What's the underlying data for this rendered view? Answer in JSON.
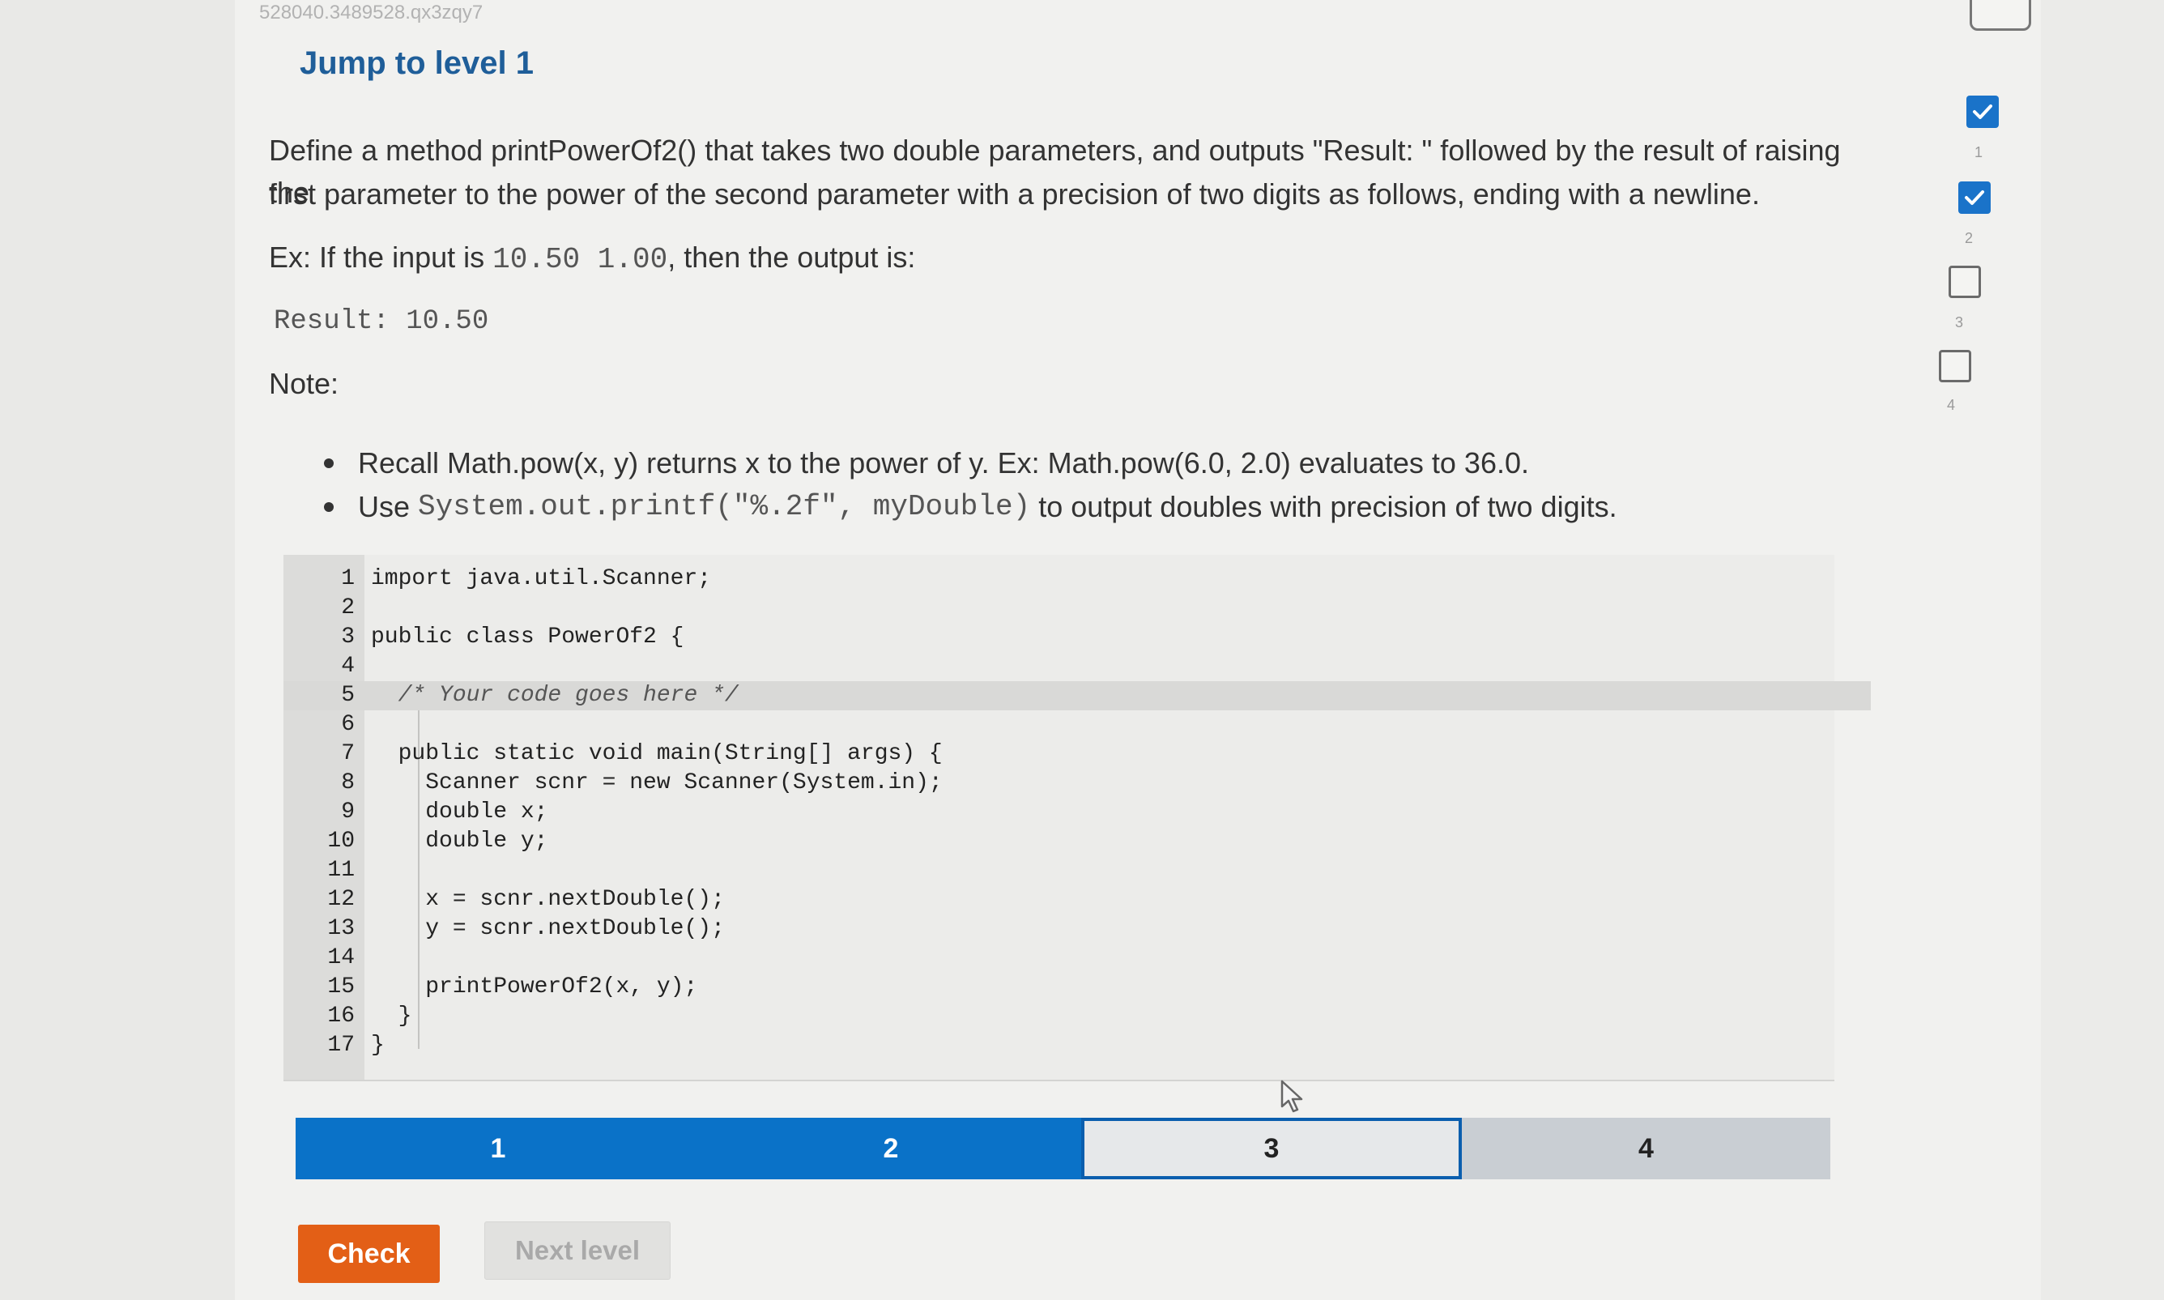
{
  "header": {
    "small_id": "528040.3489528.qx3zqy7",
    "title": "Jump to level 1"
  },
  "prompt": {
    "line1": "Define a method printPowerOf2() that takes two double parameters, and outputs \"Result: \" followed by the result of raising the",
    "line2": "first parameter to the power of the second parameter with a precision of two digits as follows, ending with a newline.",
    "example_prefix": "Ex: If the input is ",
    "example_input": "10.50 1.00",
    "example_suffix": ", then the output is:",
    "example_output": "Result: 10.50",
    "note_label": "Note:",
    "bullets": {
      "b1": "Recall Math.pow(x, y) returns x to the power of y. Ex: Math.pow(6.0, 2.0) evaluates to 36.0.",
      "b2_prefix": "Use ",
      "b2_code": "System.out.printf(\"%.2f\", myDouble)",
      "b2_suffix": " to output doubles with precision of two digits."
    }
  },
  "code": {
    "lines": [
      {
        "n": "1",
        "text": "import java.util.Scanner;"
      },
      {
        "n": "2",
        "text": ""
      },
      {
        "n": "3",
        "text": "public class PowerOf2 {"
      },
      {
        "n": "4",
        "text": ""
      },
      {
        "n": "5",
        "text": "  /* Your code goes here */"
      },
      {
        "n": "6",
        "text": ""
      },
      {
        "n": "7",
        "text": "  public static void main(String[] args) {"
      },
      {
        "n": "8",
        "text": "    Scanner scnr = new Scanner(System.in);"
      },
      {
        "n": "9",
        "text": "    double x;"
      },
      {
        "n": "10",
        "text": "    double y;"
      },
      {
        "n": "11",
        "text": ""
      },
      {
        "n": "12",
        "text": "    x = scnr.nextDouble();"
      },
      {
        "n": "13",
        "text": "    y = scnr.nextDouble();"
      },
      {
        "n": "14",
        "text": ""
      },
      {
        "n": "15",
        "text": "    printPowerOf2(x, y);"
      },
      {
        "n": "16",
        "text": "  }"
      },
      {
        "n": "17",
        "text": "}"
      }
    ]
  },
  "levels": {
    "segments": [
      {
        "label": "1",
        "state": "done"
      },
      {
        "label": "2",
        "state": "done"
      },
      {
        "label": "3",
        "state": "current"
      },
      {
        "label": "4",
        "state": "todo"
      }
    ]
  },
  "buttons": {
    "check": "Check",
    "next": "Next level"
  },
  "sidebar": {
    "items": [
      {
        "num": "1",
        "checked": true
      },
      {
        "num": "2",
        "checked": true
      },
      {
        "num": "3",
        "checked": false
      },
      {
        "num": "4",
        "checked": false
      }
    ]
  },
  "colors": {
    "title_blue": "#1f5e99",
    "progress_blue": "#0a72c8",
    "check_orange": "#e35f16"
  }
}
